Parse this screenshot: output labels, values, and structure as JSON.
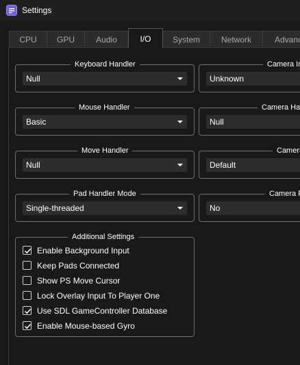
{
  "window": {
    "title": "Settings",
    "icon": "settings-app-icon",
    "accent": "#7a6cf0"
  },
  "tabs": [
    {
      "label": "CPU",
      "active": false
    },
    {
      "label": "GPU",
      "active": false
    },
    {
      "label": "Audio",
      "active": false
    },
    {
      "label": "I/O",
      "active": true
    },
    {
      "label": "System",
      "active": false
    },
    {
      "label": "Network",
      "active": false
    },
    {
      "label": "Advanced",
      "active": false
    }
  ],
  "left_groups": [
    {
      "title": "Keyboard Handler",
      "value": "Null"
    },
    {
      "title": "Mouse Handler",
      "value": "Basic"
    },
    {
      "title": "Move Handler",
      "value": "Null"
    },
    {
      "title": "Pad Handler Mode",
      "value": "Single-threaded"
    }
  ],
  "right_groups": [
    {
      "title": "Camera Input",
      "value": "Unknown"
    },
    {
      "title": "Camera Handler",
      "value": "Null"
    },
    {
      "title": "Camera",
      "value": "Default"
    },
    {
      "title": "Camera Flip",
      "value": "No"
    }
  ],
  "additional": {
    "title": "Additional Settings",
    "items": [
      {
        "label": "Enable Background Input",
        "checked": true
      },
      {
        "label": "Keep Pads Connected",
        "checked": false
      },
      {
        "label": "Show PS Move Cursor",
        "checked": false
      },
      {
        "label": "Lock Overlay Input To Player One",
        "checked": false
      },
      {
        "label": "Use SDL GameController Database",
        "checked": true
      },
      {
        "label": "Enable Mouse-based Gyro",
        "checked": true
      }
    ]
  }
}
